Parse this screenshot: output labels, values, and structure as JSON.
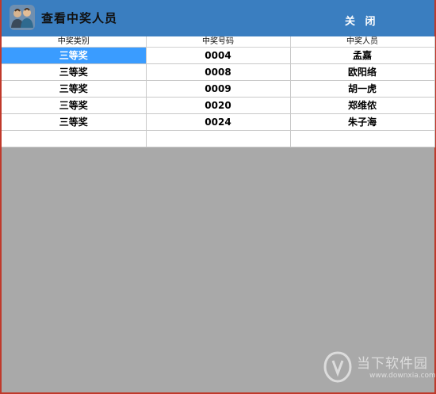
{
  "window": {
    "title": "查看中奖人员",
    "close_label": "关 闭"
  },
  "table": {
    "headers": [
      "中奖类别",
      "中奖号码",
      "中奖人员"
    ],
    "rows": [
      [
        "三等奖",
        "0004",
        "孟嘉"
      ],
      [
        "三等奖",
        "0008",
        "欧阳络"
      ],
      [
        "三等奖",
        "0009",
        "胡一虎"
      ],
      [
        "三等奖",
        "0020",
        "郑维侬"
      ],
      [
        "三等奖",
        "0024",
        "朱子海"
      ]
    ]
  },
  "watermark": {
    "text": "当下软件园",
    "url": "www.downxia.com"
  },
  "colors": {
    "titlebar": "#3a7ec0",
    "selected_cell": "#3a9cff",
    "empty_area": "#a9a9a9"
  }
}
